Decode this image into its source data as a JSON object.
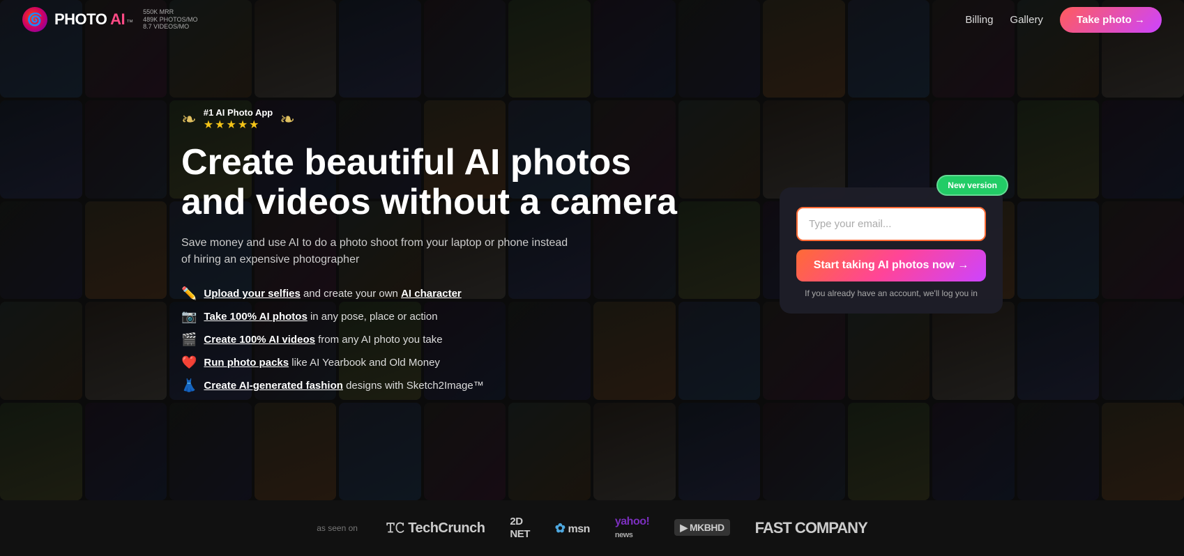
{
  "nav": {
    "logo_text": "PHOTO AI",
    "logo_tm": "™",
    "badge_line1": "550K MRR",
    "badge_line2": "489K PHOTOS/MO",
    "badge_line3": "8.7 VIDEOS/MO",
    "billing": "Billing",
    "gallery": "Gallery",
    "take_photo": "Take photo →"
  },
  "award": {
    "title": "#1 AI Photo App",
    "stars": "★★★★★"
  },
  "hero": {
    "headline": "Create beautiful AI photos\nand videos without a camera",
    "subtext": "Save money and use AI to do a photo shoot from your laptop or phone instead of hiring an expensive photographer",
    "features": [
      {
        "icon": "✏️",
        "linked": "Upload your selfies",
        "rest": " and create your own ",
        "linked2": "AI character",
        "after": ""
      },
      {
        "icon": "📷",
        "linked": "Take 100% AI photos",
        "rest": " in any pose, place or action",
        "linked2": "",
        "after": ""
      },
      {
        "icon": "🎬",
        "linked": "Create 100% AI videos",
        "rest": " from any AI photo you take",
        "linked2": "",
        "after": ""
      },
      {
        "icon": "❤️",
        "linked": "Run photo packs",
        "rest": " like AI Yearbook and Old Money",
        "linked2": "",
        "after": ""
      },
      {
        "icon": "👗",
        "linked": "Create AI-generated fashion",
        "rest": " designs with Sketch2Image™",
        "linked2": "",
        "after": ""
      }
    ]
  },
  "signup": {
    "new_version": "New version",
    "email_placeholder": "Type your email...",
    "start_button": "Start taking AI photos now →",
    "login_note": "If you already have an account, we'll log you in"
  },
  "footer": {
    "as_seen": "as seen on",
    "logos": [
      "TechCrunch",
      "2D NET",
      "msn",
      "yahoo! news",
      "MKBHD",
      "FAST COMPANY"
    ]
  },
  "tiles_count": 70
}
